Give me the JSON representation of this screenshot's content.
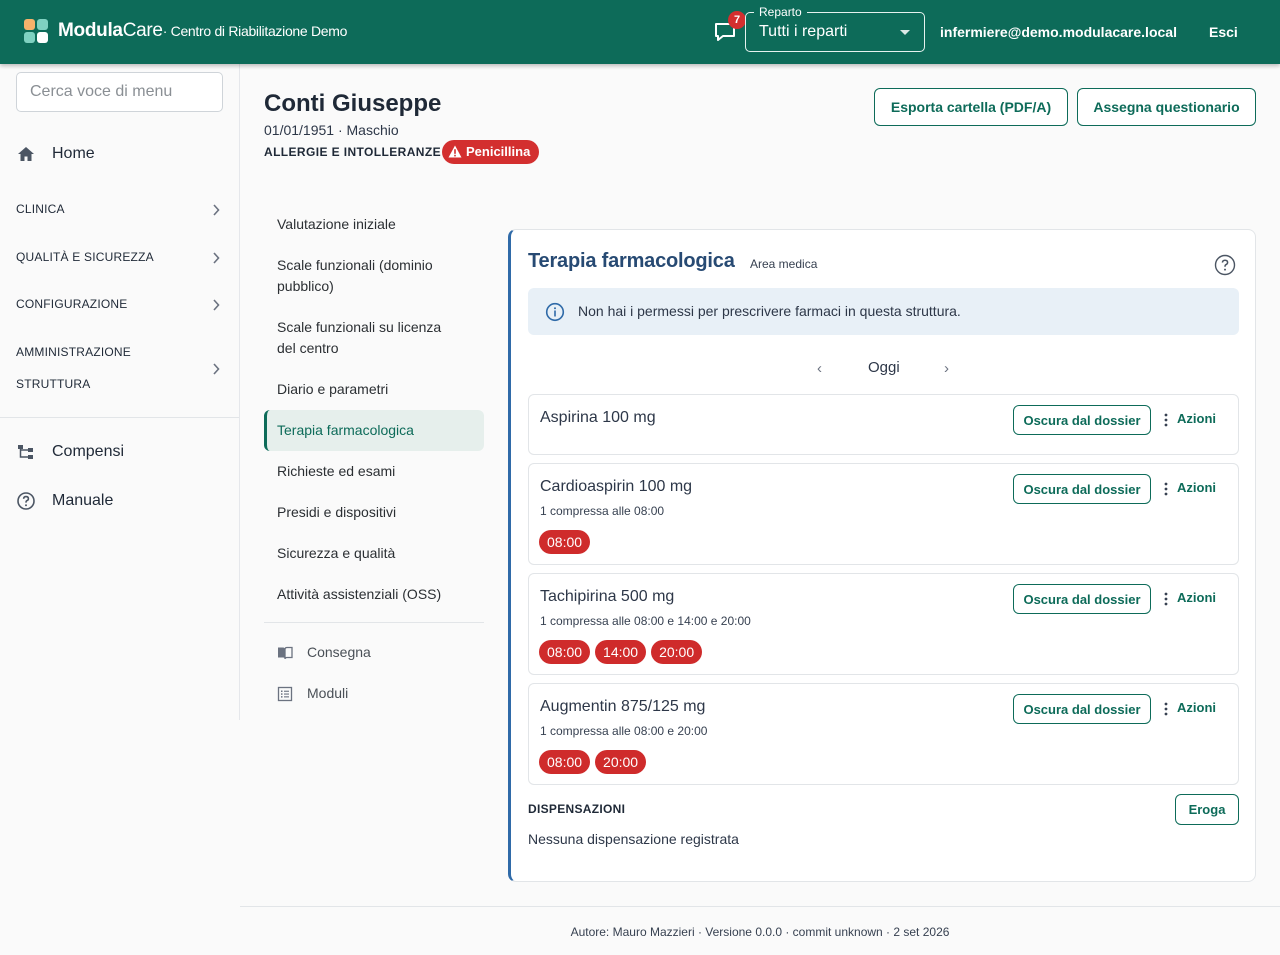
{
  "header": {
    "brand_bold": "Modula",
    "brand_regular": "Care",
    "brand_sub": "· Centro di Riabilitazione Demo",
    "notifications_count": "7",
    "department_label": "Reparto",
    "department_value": "Tutti i reparti",
    "user_email": "infermiere@demo.modulacare.local",
    "logout_label": "Esci",
    "colors": {
      "primary": "#0d6b59",
      "badge": "#d32f2f"
    }
  },
  "sidebar": {
    "search_placeholder": "Cerca voce di menu",
    "home_label": "Home",
    "sections": [
      {
        "label": "CLINICA"
      },
      {
        "label": "QUALITÀ E SICUREZZA"
      },
      {
        "label": "CONFIGURAZIONE"
      },
      {
        "label_line1": "AMMINISTRAZIONE",
        "label_line2": "STRUTTURA"
      }
    ],
    "items": [
      {
        "label": "Compensi",
        "icon": "hierarchy-icon"
      },
      {
        "label": "Manuale",
        "icon": "help-circle-icon"
      }
    ]
  },
  "patient": {
    "name": "Conti Giuseppe",
    "meta": "01/01/1951 · Maschio",
    "allergy_label": "ALLERGIE E INTOLLERANZE",
    "allergy_chip": "Penicillina"
  },
  "actions": {
    "export_label": "Esporta cartella (PDF/A)",
    "questionnaire_label": "Assegna questionario"
  },
  "subnav": {
    "items": [
      {
        "line1": "Valutazione iniziale"
      },
      {
        "line1": "Scale funzionali (dominio",
        "line2": "pubblico)"
      },
      {
        "line1": "Scale funzionali su licenza",
        "line2": "del centro"
      },
      {
        "line1": "Diario e parametri"
      },
      {
        "line1": "Terapia farmacologica",
        "active": true
      },
      {
        "line1": "Richieste ed esami"
      },
      {
        "line1": "Presidi e dispositivi"
      },
      {
        "line1": "Sicurezza e qualità"
      },
      {
        "line1": "Attività assistenziali (OSS)"
      }
    ],
    "tools": [
      {
        "label": "Consegna",
        "icon": "book-icon"
      },
      {
        "label": "Moduli",
        "icon": "list-icon"
      }
    ]
  },
  "therapy": {
    "title": "Terapia farmacologica",
    "tag": "Area medica",
    "info_message": "Non hai i permessi per prescrivere farmaci in questa struttura.",
    "date_label": "Oggi",
    "date_prev": "‹",
    "date_next": "›",
    "hide_label": "Oscura dal dossier",
    "actions_label": "Azioni",
    "medications": [
      {
        "name": "Aspirina 100 mg",
        "schedule": "",
        "times": []
      },
      {
        "name": "Cardioaspirin 100 mg",
        "schedule": "1 compressa alle 08:00",
        "times": [
          "08:00"
        ]
      },
      {
        "name": "Tachipirina 500 mg",
        "schedule": "1 compressa alle 08:00 e 14:00 e 20:00",
        "times": [
          "08:00",
          "14:00",
          "20:00"
        ]
      },
      {
        "name": "Augmentin 875/125 mg",
        "schedule": "1 compressa alle 08:00 e 20:00",
        "times": [
          "08:00",
          "20:00"
        ]
      }
    ],
    "dispensations_title": "DISPENSAZIONI",
    "dispense_label": "Eroga",
    "dispensations_empty": "Nessuna dispensazione registrata",
    "colors": {
      "title": "#274a73",
      "accent_border": "#2f6aa8",
      "time_chip": "#cf2b2b",
      "info_bg": "#e8f0f7"
    }
  },
  "footer": {
    "text": "Autore: Mauro Mazzieri · Versione 0.0.0 · commit unknown · 2 set 2026"
  }
}
